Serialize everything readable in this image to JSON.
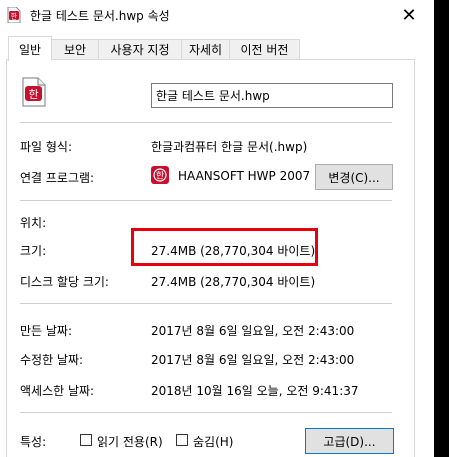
{
  "window": {
    "title": "한글 테스트 문서.hwp 속성",
    "close_glyph": "✕"
  },
  "tabs": [
    {
      "label": "일반",
      "active": true
    },
    {
      "label": "보안",
      "active": false
    },
    {
      "label": "사용자 지정",
      "active": false
    },
    {
      "label": "자세히",
      "active": false
    },
    {
      "label": "이전 버전",
      "active": false
    }
  ],
  "general": {
    "file_name": "한글 테스트 문서.hwp",
    "file_type_label": "파일 형식:",
    "file_type_value": "한글과컴퓨터 한글 문서(.hwp)",
    "open_with_label": "연결 프로그램:",
    "open_with_value": "HAANSOFT HWP 2007",
    "change_button": "변경(C)...",
    "location_label": "위치:",
    "size_label": "크기:",
    "size_value": "27.4MB (28,770,304 바이트)",
    "disk_size_label": "디스크 할당 크기:",
    "disk_size_value": "27.4MB (28,770,304 바이트)",
    "created_label": "만든 날짜:",
    "created_value": "2017년 8월 6일 일요일, 오전 2:43:00",
    "modified_label": "수정한 날짜:",
    "modified_value": "2017년 8월 6일 일요일, 오전 2:43:00",
    "accessed_label": "액세스한 날짜:",
    "accessed_value": "2018년 10월 16일 오늘, 오전 9:41:37",
    "attributes_label": "특성:",
    "readonly_label": "읽기 전용(R)",
    "hidden_label": "숨김(H)",
    "advanced_button": "고급(D)..."
  },
  "colors": {
    "highlight": "#e8000f",
    "hwp_icon": "#c8102e",
    "focus": "#0078d7"
  }
}
